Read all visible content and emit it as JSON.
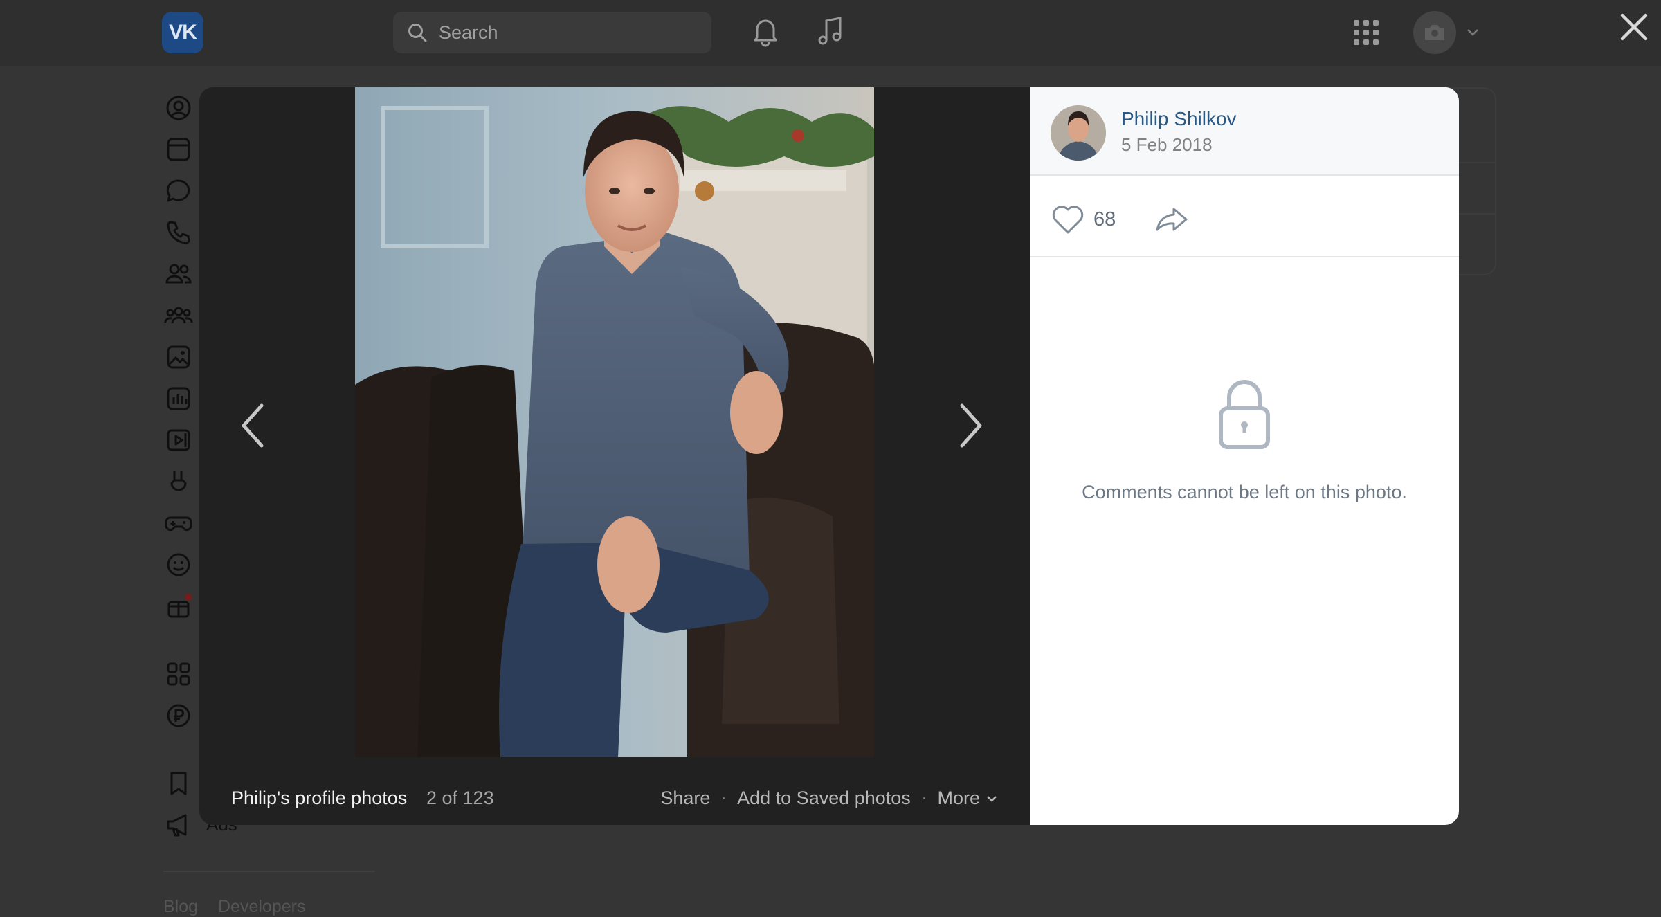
{
  "topbar": {
    "logo_text": "VK",
    "search_placeholder": "Search",
    "icons": [
      "bell-icon",
      "music-icon",
      "apps-grid-icon",
      "camera-icon",
      "chevron-down-icon",
      "close-icon"
    ]
  },
  "sidebar": {
    "icons": [
      "profile-icon",
      "news-icon",
      "messenger-icon",
      "calls-icon",
      "friends-icon",
      "communities-icon",
      "photos-icon",
      "music-icon",
      "video-icon",
      "clips-icon",
      "games-icon",
      "stickers-icon",
      "gifts-icon",
      "services-icon",
      "payments-icon",
      "bookmarks-icon",
      "ads-icon"
    ],
    "ads_label": "Ads",
    "footer_links": [
      "Blog",
      "Developers"
    ]
  },
  "viewer": {
    "album_title": "Philip's profile photos",
    "counter": "2 of 123",
    "actions": {
      "share": "Share",
      "save": "Add to Saved photos",
      "more": "More"
    }
  },
  "info": {
    "author_name": "Philip Shilkov",
    "date": "5 Feb 2018",
    "likes": "68",
    "comments_locked_text": "Comments cannot be left on this photo."
  },
  "colors": {
    "page_bg": "#353535",
    "modal_photo_bg": "#212121",
    "link_blue": "#2a5885",
    "logo_bg": "#1d4a85"
  }
}
